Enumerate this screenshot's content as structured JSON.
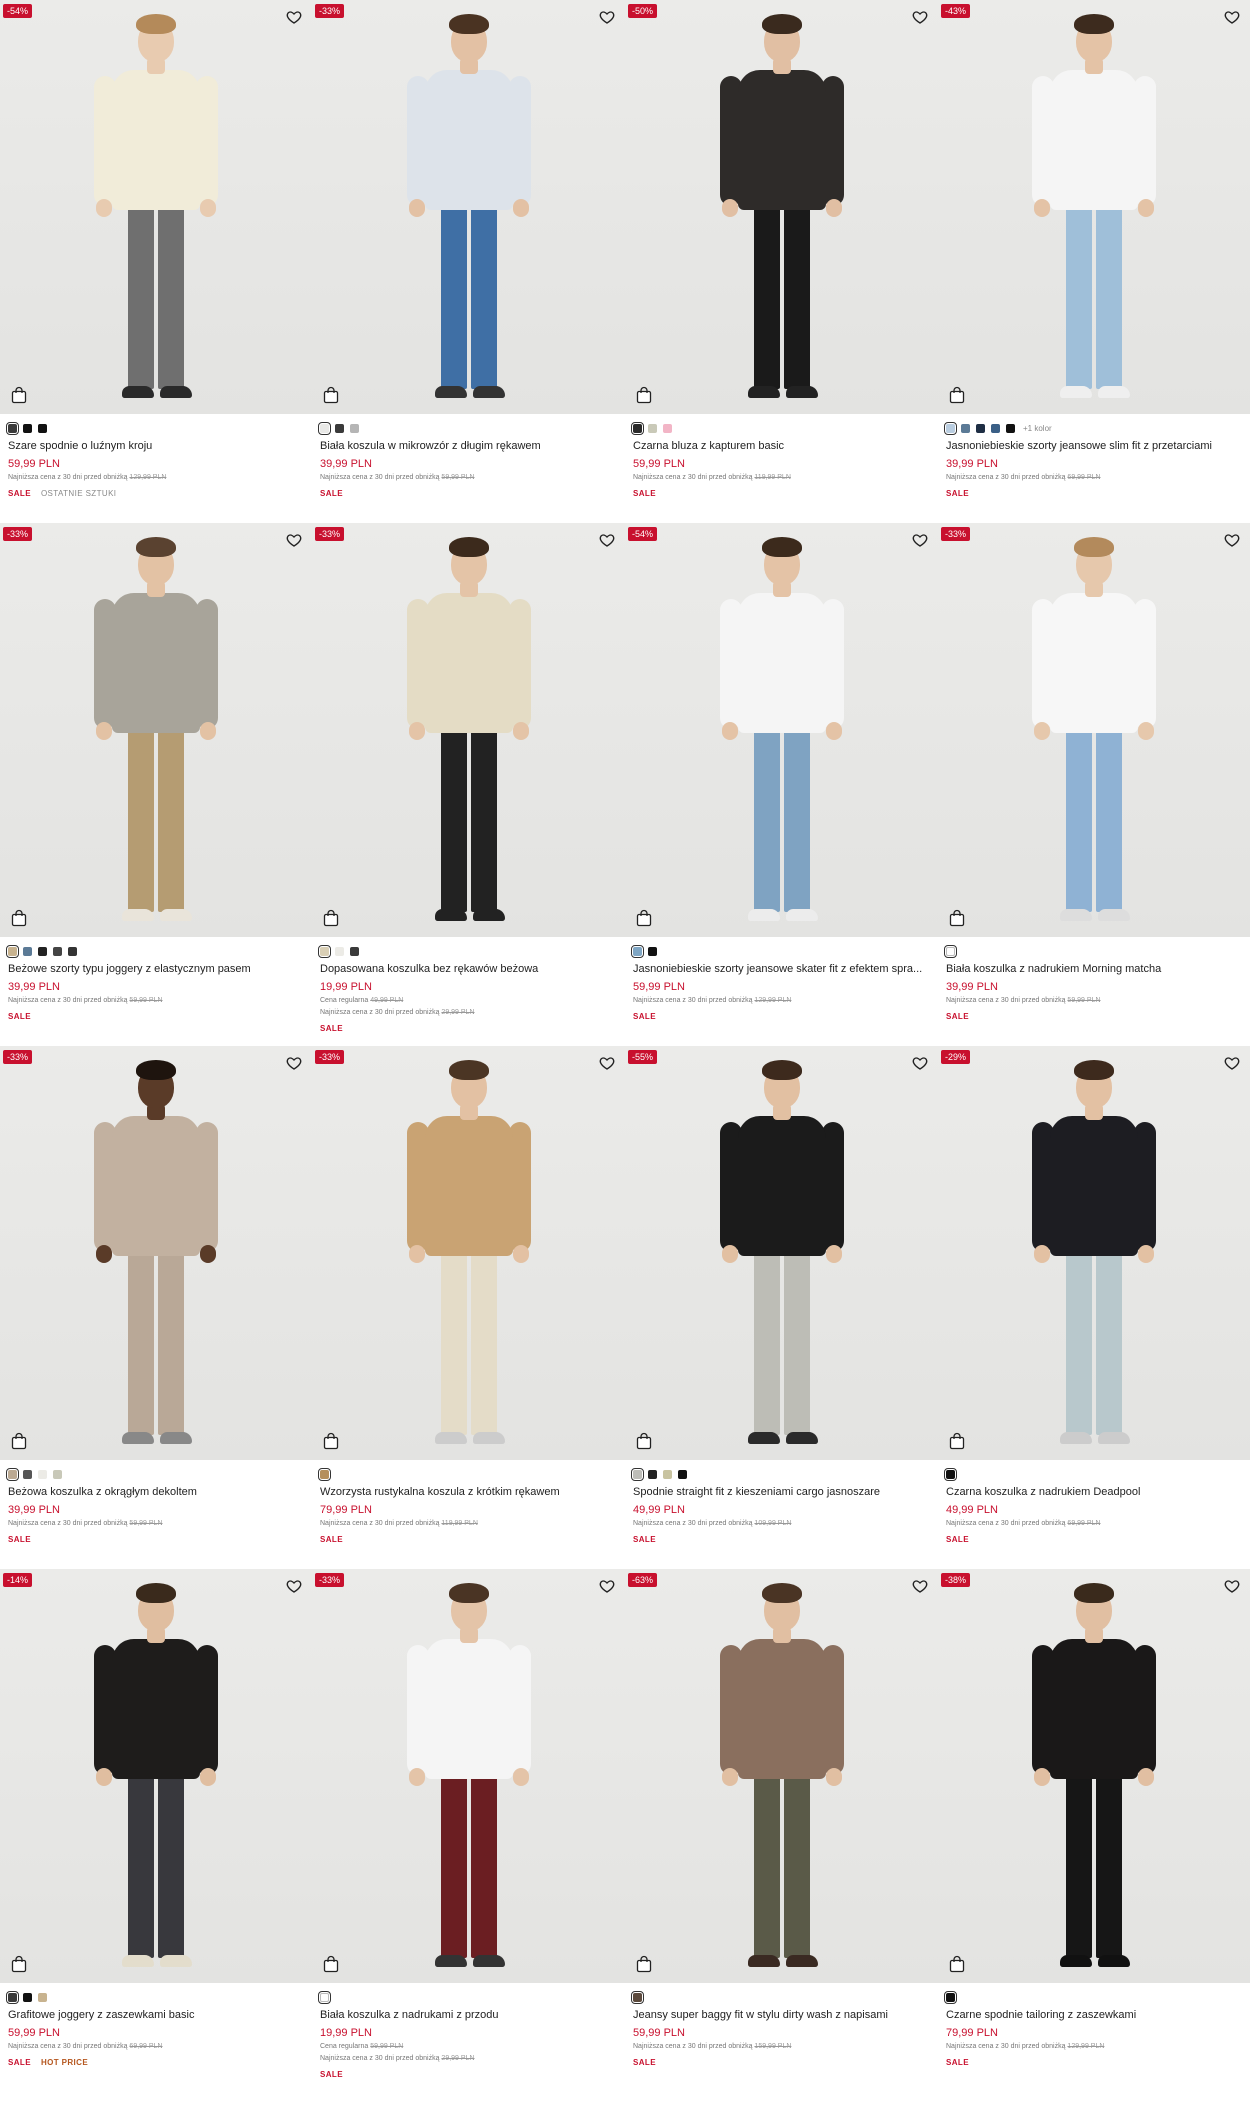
{
  "products": [
    {
      "discount": "-54%",
      "swatches": [
        "#3b3b3b",
        "#111111",
        "#111111"
      ],
      "name": "Szare spodnie o luźnym kroju",
      "price": "59,99 PLN",
      "regular": "",
      "lowest_label": "Najniższa cena z 30 dni przed obniżką",
      "lowest_value": "129,99 PLN",
      "tags": [
        "SALE",
        "OSTATNIE SZTUKI"
      ],
      "colors": {
        "skin": "#e8cbb0",
        "hair": "#b48a5a",
        "top": "#f1ecd9",
        "bottom": "#6f6f6f",
        "shoe": "#2a2a2a"
      }
    },
    {
      "discount": "-33%",
      "swatches": [
        "#e8e8e6",
        "#3a3a3a",
        "#b5b5b5"
      ],
      "name": "Biała koszula w mikrowzór z długim rękawem",
      "price": "39,99 PLN",
      "regular": "",
      "lowest_label": "Najniższa cena z 30 dni przed obniżką",
      "lowest_value": "59,99 PLN",
      "tags": [
        "SALE"
      ],
      "colors": {
        "skin": "#e3c1a4",
        "hair": "#4a3322",
        "top": "#dde3ea",
        "bottom": "#3f6fa5",
        "shoe": "#333"
      }
    },
    {
      "discount": "-50%",
      "swatches": [
        "#2a2a2a",
        "#c9c9b8",
        "#f2b5c6"
      ],
      "name": "Czarna bluza z kapturem basic",
      "price": "59,99 PLN",
      "regular": "",
      "lowest_label": "Najniższa cena z 30 dni przed obniżką",
      "lowest_value": "119,99 PLN",
      "tags": [
        "SALE"
      ],
      "colors": {
        "skin": "#e1bfa3",
        "hair": "#3a2a1e",
        "top": "#2e2b29",
        "bottom": "#1a1a1a",
        "shoe": "#222"
      }
    },
    {
      "discount": "-43%",
      "swatches": [
        "#b9cde0",
        "#5b7a96",
        "#1e2e44",
        "#3a5f86",
        "#111111"
      ],
      "more": "+1 kolor",
      "name": "Jasnoniebieskie szorty jeansowe slim fit z przetarciami",
      "price": "39,99 PLN",
      "regular": "",
      "lowest_label": "Najniższa cena z 30 dni przed obniżką",
      "lowest_value": "69,99 PLN",
      "tags": [
        "SALE"
      ],
      "colors": {
        "skin": "#e4c3a6",
        "hair": "#3d2b1e",
        "top": "#f5f5f5",
        "bottom": "#9fbfd9",
        "shoe": "#efefef"
      }
    },
    {
      "discount": "-33%",
      "swatches": [
        "#c8b38f",
        "#5b7a96",
        "#222222",
        "#444444",
        "#333333"
      ],
      "name": "Beżowe szorty typu joggery z elastycznym pasem",
      "price": "39,99 PLN",
      "regular": "",
      "lowest_label": "Najniższa cena z 30 dni przed obniżką",
      "lowest_value": "59,99 PLN",
      "tags": [
        "SALE"
      ],
      "colors": {
        "skin": "#e3c2a4",
        "hair": "#5a4230",
        "top": "#a8a49a",
        "bottom": "#b59c72",
        "shoe": "#e9e4da"
      }
    },
    {
      "discount": "-33%",
      "swatches": [
        "#d9cfb5",
        "#ecebe6",
        "#3a3a3a"
      ],
      "name": "Dopasowana koszulka bez rękawów beżowa",
      "price": "19,99 PLN",
      "regular_label": "Cena regularna",
      "regular": "49,99 PLN",
      "lowest_label": "Najniższa cena z 30 dni przed obniżką",
      "lowest_value": "29,99 PLN",
      "tags": [
        "SALE"
      ],
      "colors": {
        "skin": "#e4c4a7",
        "hair": "#3c2a1c",
        "top": "#e4dcc5",
        "bottom": "#222",
        "shoe": "#222"
      }
    },
    {
      "discount": "-54%",
      "swatches": [
        "#7fa6c4",
        "#111111"
      ],
      "name": "Jasnoniebieskie szorty jeansowe skater fit z efektem spra...",
      "price": "59,99 PLN",
      "regular": "",
      "lowest_label": "Najniższa cena z 30 dni przed obniżką",
      "lowest_value": "129,99 PLN",
      "tags": [
        "SALE"
      ],
      "colors": {
        "skin": "#e4c3a6",
        "hair": "#3c2a1c",
        "top": "#f5f5f5",
        "bottom": "#7fa3c2",
        "shoe": "#ececec"
      }
    },
    {
      "discount": "-33%",
      "swatches": [
        "#ffffff"
      ],
      "name": "Biała koszulka z nadrukiem Morning matcha",
      "price": "39,99 PLN",
      "regular": "",
      "lowest_label": "Najniższa cena z 30 dni przed obniżką",
      "lowest_value": "59,99 PLN",
      "tags": [
        "SALE"
      ],
      "colors": {
        "skin": "#e6c8ac",
        "hair": "#b38a5c",
        "top": "#f7f7f7",
        "bottom": "#8fb2d4",
        "shoe": "#ddd"
      }
    },
    {
      "discount": "-33%",
      "swatches": [
        "#bba992",
        "#555555",
        "#ecebe6",
        "#c8c8b8"
      ],
      "name": "Beżowa koszulka z okrągłym dekoltem",
      "price": "39,99 PLN",
      "regular": "",
      "lowest_label": "Najniższa cena z 30 dni przed obniżką",
      "lowest_value": "59,99 PLN",
      "tags": [
        "SALE"
      ],
      "colors": {
        "skin": "#5a3b28",
        "hair": "#1e140e",
        "top": "#c2b1a0",
        "bottom": "#b9a897",
        "shoe": "#888"
      }
    },
    {
      "discount": "-33%",
      "swatches": [
        "#b58f5c"
      ],
      "name": "Wzorzysta rustykalna koszula z krótkim rękawem",
      "price": "79,99 PLN",
      "regular": "",
      "lowest_label": "Najniższa cena z 30 dni przed obniżką",
      "lowest_value": "119,99 PLN",
      "tags": [
        "SALE"
      ],
      "colors": {
        "skin": "#e3c1a3",
        "hair": "#4b3524",
        "top": "#c9a373",
        "bottom": "#e4dcc8",
        "shoe": "#ccc"
      }
    },
    {
      "discount": "-55%",
      "swatches": [
        "#bdbdb8",
        "#222222",
        "#c8c3a0",
        "#111111"
      ],
      "name": "Spodnie straight fit z kieszeniami cargo jasnoszare",
      "price": "49,99 PLN",
      "regular": "",
      "lowest_label": "Najniższa cena z 30 dni przed obniżką",
      "lowest_value": "109,99 PLN",
      "tags": [
        "SALE"
      ],
      "colors": {
        "skin": "#e2c0a2",
        "hair": "#3d2a1d",
        "top": "#1b1b1b",
        "bottom": "#bdbdb6",
        "shoe": "#2a2a2a"
      }
    },
    {
      "discount": "-29%",
      "swatches": [
        "#111111"
      ],
      "name": "Czarna koszulka z nadrukiem Deadpool",
      "price": "49,99 PLN",
      "regular": "",
      "lowest_label": "Najniższa cena z 30 dni przed obniżką",
      "lowest_value": "69,99 PLN",
      "tags": [
        "SALE"
      ],
      "colors": {
        "skin": "#e3c1a3",
        "hair": "#3d2a1d",
        "top": "#1d1d22",
        "bottom": "#b8c8cc",
        "shoe": "#ccc"
      }
    },
    {
      "discount": "-14%",
      "swatches": [
        "#3a3a3a",
        "#111111",
        "#c8b38f"
      ],
      "name": "Grafitowe joggery z zaszewkami basic",
      "price": "59,99 PLN",
      "regular": "",
      "lowest_label": "Najniższa cena z 30 dni przed obniżką",
      "lowest_value": "69,99 PLN",
      "tags": [
        "SALE",
        "HOT PRICE"
      ],
      "colors": {
        "skin": "#e0bea0",
        "hair": "#3a2a1c",
        "top": "#1e1c1b",
        "bottom": "#38383d",
        "shoe": "#e3ddcc"
      }
    },
    {
      "discount": "-33%",
      "swatches": [
        "#ffffff"
      ],
      "name": "Biała koszulka z nadrukami z przodu",
      "price": "19,99 PLN",
      "regular_label": "Cena regularna",
      "regular": "59,99 PLN",
      "lowest_label": "Najniższa cena z 30 dni przed obniżką",
      "lowest_value": "29,99 PLN",
      "tags": [
        "SALE"
      ],
      "colors": {
        "skin": "#e4c4a8",
        "hair": "#4a3424",
        "top": "#f5f5f5",
        "bottom": "#6b1e22",
        "shoe": "#333"
      }
    },
    {
      "discount": "-63%",
      "swatches": [
        "#5c4a3d"
      ],
      "name": "Jeansy super baggy fit w stylu dirty wash z napisami",
      "price": "59,99 PLN",
      "regular": "",
      "lowest_label": "Najniższa cena z 30 dni przed obniżką",
      "lowest_value": "159,99 PLN",
      "tags": [
        "SALE"
      ],
      "colors": {
        "skin": "#e1bfa2",
        "hair": "#4a3424",
        "top": "#8a6f5e",
        "bottom": "#5a5a48",
        "shoe": "#3a2a22"
      }
    },
    {
      "discount": "-38%",
      "swatches": [
        "#111111"
      ],
      "name": "Czarne spodnie tailoring z zaszewkami",
      "price": "79,99 PLN",
      "regular": "",
      "lowest_label": "Najniższa cena z 30 dni przed obniżką",
      "lowest_value": "129,99 PLN",
      "tags": [
        "SALE"
      ],
      "colors": {
        "skin": "#e1bfa2",
        "hair": "#3a2a1c",
        "top": "#1a1818",
        "bottom": "#161616",
        "shoe": "#111"
      }
    }
  ]
}
